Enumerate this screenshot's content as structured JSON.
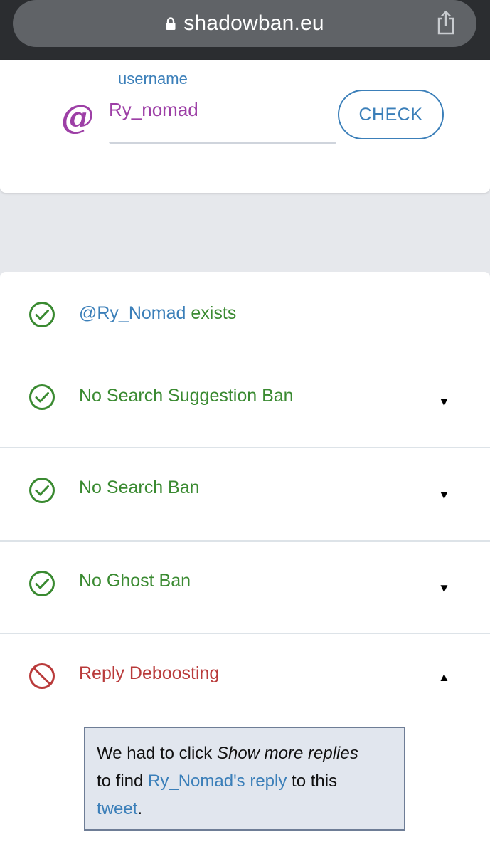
{
  "browser": {
    "url": "shadowban.eu",
    "icons": {
      "lock": "lock-icon",
      "share": "share-icon"
    }
  },
  "search": {
    "label": "username",
    "at_symbol": "@",
    "value": "Ry_nomad",
    "button_label": "CHECK"
  },
  "results": {
    "exists": {
      "handle": "@Ry_Nomad",
      "text": "exists"
    },
    "items": [
      {
        "label": "No Search Suggestion Ban",
        "status": "ok",
        "caret": "▼"
      },
      {
        "label": "No Search Ban",
        "status": "ok",
        "caret": "▼"
      },
      {
        "label": "No Ghost Ban",
        "status": "ok",
        "caret": "▼"
      },
      {
        "label": "Reply Deboosting",
        "status": "ban",
        "caret": "▲"
      }
    ],
    "detail": {
      "part1": "We had to click ",
      "emphasis": "Show more replies",
      "part2": "to find ",
      "link1": "Ry_Nomad's reply",
      "part3": " to this",
      "link2": "tweet",
      "part4": "."
    }
  },
  "colors": {
    "ok": "#3a8a31",
    "ban": "#b93a3a",
    "link": "#3b7fb9",
    "at": "#9d3fa6"
  }
}
